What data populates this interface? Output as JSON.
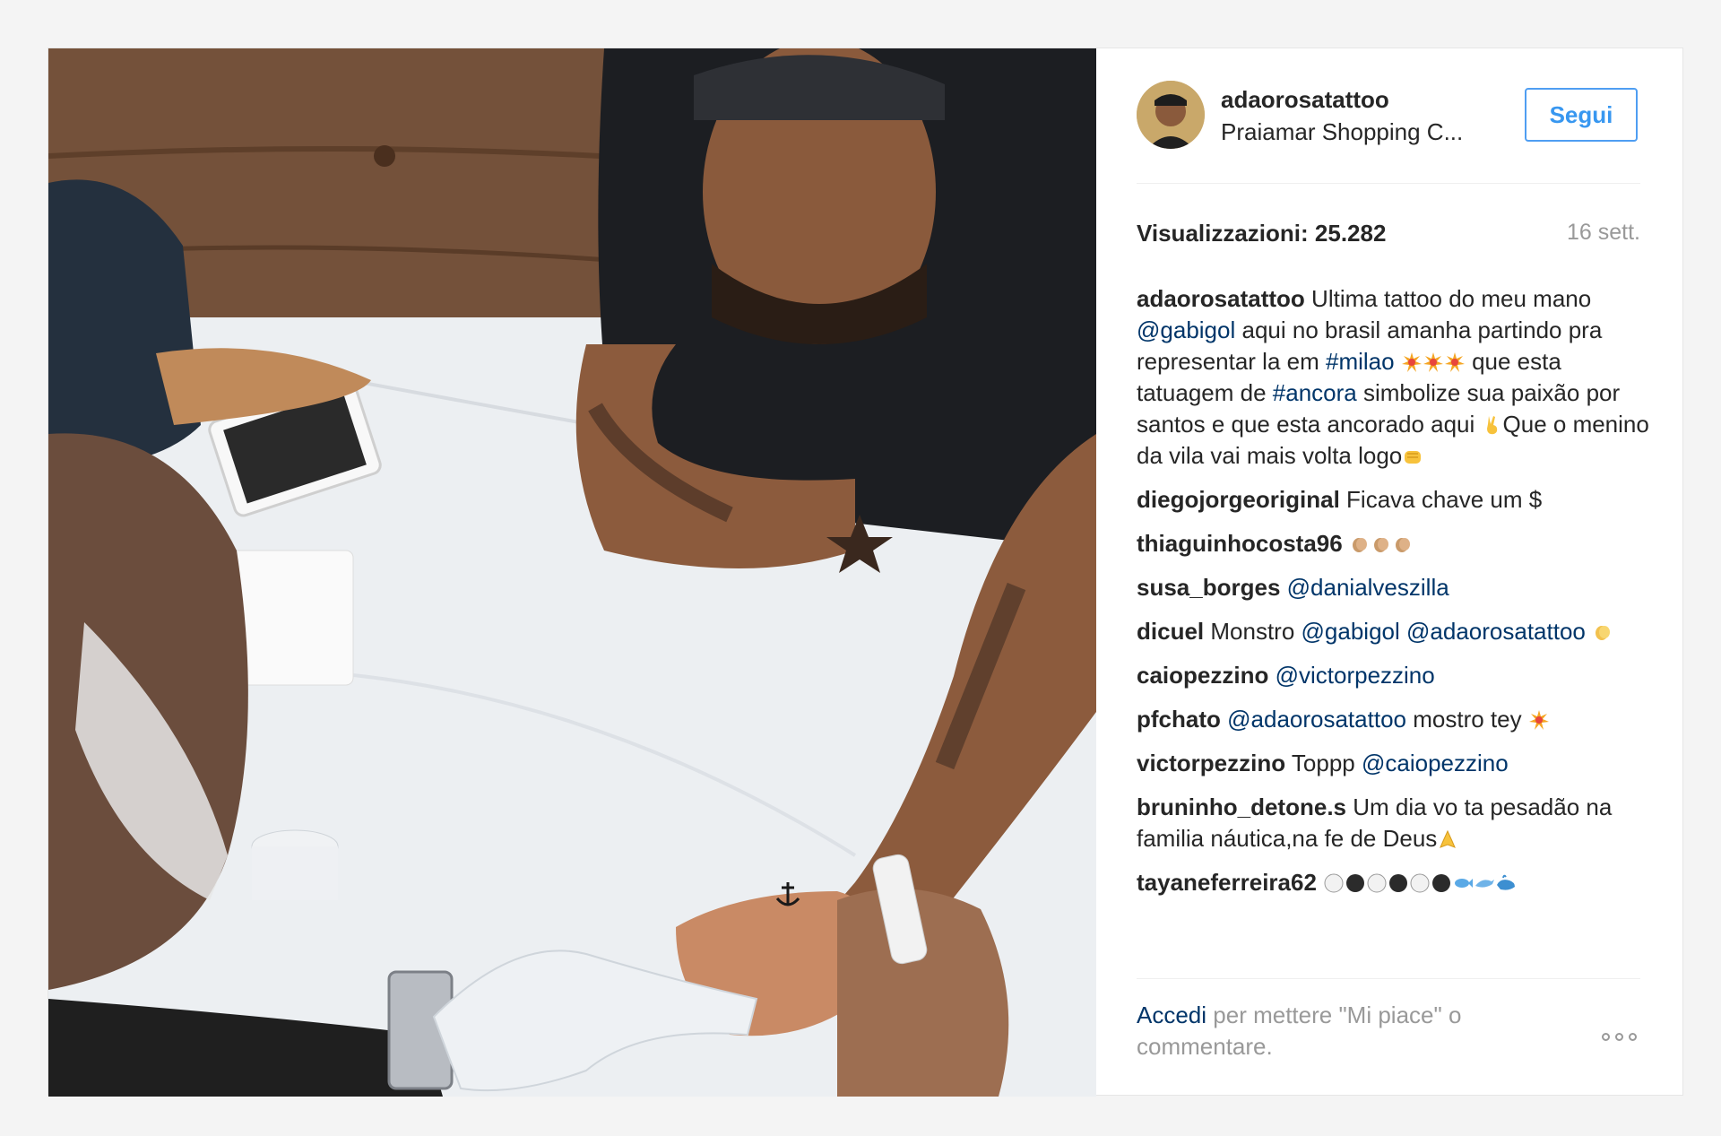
{
  "post": {
    "owner": {
      "username": "adaorosatattoo",
      "location": "Praiamar Shopping C..."
    },
    "follow_label": "Segui",
    "views_label": "Visualizzazioni: 25.282",
    "time_ago": "16 sett."
  },
  "caption": {
    "user": "adaorosatattoo",
    "t1": "Ultima tattoo do meu mano",
    "mention1": "@gabigol",
    "t2": "aqui no brasil amanha partindo pra representar la em",
    "tag1": "#milao",
    "t3": "que esta tatuagem de",
    "tag2": "#ancora",
    "t4": "simbolize sua paixão por santos e que esta ancorado aqui",
    "t5": "Que o menino da vila vai mais volta logo"
  },
  "comments": [
    {
      "user": "diegojorgeoriginal",
      "text": "Ficava chave um $"
    },
    {
      "user": "thiaguinhocosta96"
    },
    {
      "user": "susa_borges",
      "mention": "@danialveszilla"
    },
    {
      "user": "dicuel",
      "text": "Monstro",
      "mention1": "@gabigol",
      "mention2": "@adaorosatattoo"
    },
    {
      "user": "caiopezzino",
      "mention": "@victorpezzino"
    },
    {
      "user": "pfchato",
      "mention": "@adaorosatattoo",
      "text": "mostro tey"
    },
    {
      "user": "victorpezzino",
      "text": "Toppp",
      "mention": "@caiopezzino"
    },
    {
      "user": "bruninho_detone.s",
      "text": "Um dia vo ta pesadão na familia náutica,na fe de Deus"
    },
    {
      "user": "tayaneferreira62"
    }
  ],
  "footer": {
    "login_link": "Accedi",
    "login_text": "per mettere \"Mi piace\" o commentare."
  },
  "icons": {
    "more": "more-options-icon"
  },
  "colors": {
    "link": "#003569",
    "accent": "#3897f0",
    "muted": "#999999"
  }
}
